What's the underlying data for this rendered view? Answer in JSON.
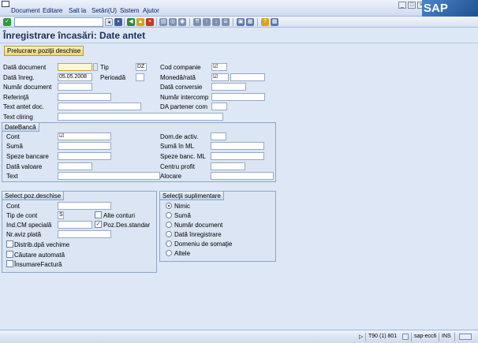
{
  "menu": [
    "Document",
    "Editare",
    "Salt la",
    "Setări(U)",
    "Sistem",
    "Ajutor"
  ],
  "page_title": "Înregistrare încasări: Date antet",
  "app_button": "Prelucrare poziţii deschise",
  "header": {
    "doc_date_label": "Dată document",
    "type_label": "Tip",
    "type_value": "DZ",
    "company_label": "Cod companie",
    "post_date_label": "Dată înreg.",
    "post_date_value": "05.05.2008",
    "period_label": "Perioadă",
    "currency_label": "Monedă/rată",
    "doc_number_label": "Număr document",
    "conv_date_label": "Dată conversie",
    "reference_label": "Referinţă",
    "intercomp_label": "Număr intercomp",
    "header_text_label": "Text antet doc.",
    "da_partner_label": "DA partener com",
    "clearing_text_label": "Text cliring"
  },
  "bank": {
    "title": "DateBancă",
    "account_label": "Cont",
    "business_area_label": "Dom.de activ.",
    "amount_label": "Sumă",
    "amount_lc_label": "Sumă în ML",
    "bank_charges_label": "Speze bancare",
    "bank_charges_lc_label": "Speze banc. ML",
    "value_date_label": "Dată valoare",
    "profit_center_label": "Centru profit",
    "text_label": "Text",
    "assignment_label": "Alocare"
  },
  "selection": {
    "title": "Select.poz.deschise",
    "account_label": "Cont",
    "account_type_label": "Tip de cont",
    "account_type_value": "S",
    "other_accounts_label": "Alte conturi",
    "special_gl_label": "Ind.CM specială",
    "std_open_items_label": "Poz.Des.standar",
    "payment_advice_label": "Nr.aviz plată",
    "distrib_label": "Distrib.dpă vechime",
    "auto_search_label": "Căutare automată",
    "invoice_insure_label": "ÎnsumareFactură"
  },
  "extra": {
    "title": "Selecţii suplimentare",
    "options": [
      "Nimic",
      "Sumă",
      "Număr document",
      "Dată înregistrare",
      "Domeniu de somaţie",
      "Altele"
    ]
  },
  "status": {
    "system": "T90 (1) 801",
    "server": "sap-ecc6",
    "mode": "INS"
  },
  "icons": {
    "enter": "green-check-icon",
    "save": "save-icon",
    "back": "back-icon",
    "exit": "exit-icon",
    "cancel": "cancel-icon",
    "help": "help-icon"
  },
  "colors": {
    "background": "#dee7f5",
    "title": "#1c2f5c",
    "button": "#f0d57a"
  }
}
